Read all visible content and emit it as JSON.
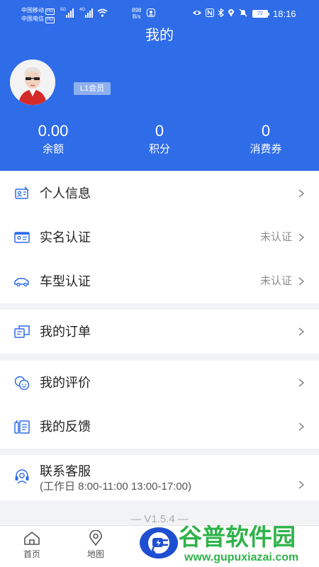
{
  "status_bar": {
    "carrier1": "中国移动",
    "carrier2": "中国电信",
    "hd": "HD",
    "net1": "5G",
    "net2": "4G",
    "speed_value": "898",
    "speed_unit": "B/s",
    "battery": "72",
    "time": "18:16"
  },
  "header": {
    "title": "我的"
  },
  "profile": {
    "member_level": "L1会员"
  },
  "stats": [
    {
      "value": "0.00",
      "label": "余额"
    },
    {
      "value": "0",
      "label": "积分"
    },
    {
      "value": "0",
      "label": "消费券"
    }
  ],
  "account_menu": [
    {
      "label": "个人信息",
      "status": "",
      "icon": "id-card-edit-icon"
    },
    {
      "label": "实名认证",
      "status": "未认证",
      "icon": "id-card-icon"
    },
    {
      "label": "车型认证",
      "status": "未认证",
      "icon": "car-icon"
    }
  ],
  "orders_menu": {
    "label": "我的订单",
    "icon": "order-icon"
  },
  "feedback_menu": [
    {
      "label": "我的评价",
      "icon": "review-icon"
    },
    {
      "label": "我的反馈",
      "icon": "feedback-icon"
    }
  ],
  "support": {
    "label": "联系客服",
    "hours": "(工作日 8:00-11:00 13:00-17:00)",
    "icon": "headset-icon"
  },
  "version_text": "— V1.5.4 —",
  "tabbar": [
    {
      "label": "首页",
      "icon": "home-icon"
    },
    {
      "label": "地图",
      "icon": "map-pin-icon"
    },
    {
      "label": "",
      "icon": "charging-plug-icon"
    }
  ],
  "watermark": {
    "text": "谷普软件园",
    "url": "www.gupuxiazai.com"
  },
  "colors": {
    "primary": "#2f6ce8",
    "icon_blue": "#2f6ce8",
    "watermark_green": "#2fb34a",
    "background": "#f2f3f5"
  }
}
